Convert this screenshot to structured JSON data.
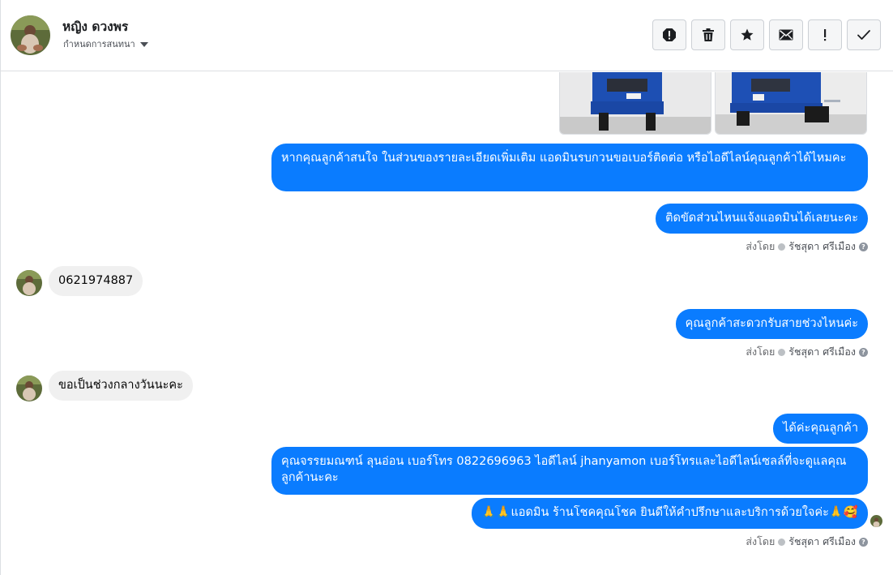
{
  "header": {
    "contact_name": "หญิง ดวงพร",
    "assign_label": "กำหนดการสนทนา",
    "actions": [
      {
        "icon": "spam-alert-icon"
      },
      {
        "icon": "trash-icon"
      },
      {
        "icon": "star-icon"
      },
      {
        "icon": "envelope-icon"
      },
      {
        "icon": "follow-up-icon"
      },
      {
        "icon": "checkmark-icon"
      }
    ]
  },
  "messages": {
    "m1": "หากคุณลูกค้าสนใจ ในส่วนของรายละเอียดเพิ่มเติม แอดมินรบกวนขอเบอร์ติดต่อ หรือไอดีไลน์คุณลูกค้าได้ไหมคะ",
    "m2": "ติดขัดส่วนไหนแจ้งแอดมินได้เลยนะคะ",
    "in1": "0621974887",
    "m3": "คุณลูกค้าสะดวกรับสายช่วงไหนค่ะ",
    "in2": "ขอเป็นช่วงกลางวันนะคะ",
    "m4": "ได้ค่ะคุณลูกค้า",
    "m5": "คุณจรรยมณฑน์ ลุนอ่อน เบอร์โทร 0822696963  ไอดีไลน์  jhanyamon   เบอร์โทรและไอดีไลน์เซลล์ที่จะดูแลคุณลูกค้านะคะ",
    "m6": "🙏🙏แอดมิน ร้านโชคคุณโชค ยินดีให้คำปรึกษาและบริการด้วยใจค่ะ🙏🥰"
  },
  "sent_by": {
    "prefix": "ส่งโดย",
    "agent": "รัชสุดา ศรีเมือง",
    "help": "?"
  },
  "colors": {
    "outgoing_bubble": "#0a7cff",
    "incoming_bubble": "#f0f0f0"
  }
}
